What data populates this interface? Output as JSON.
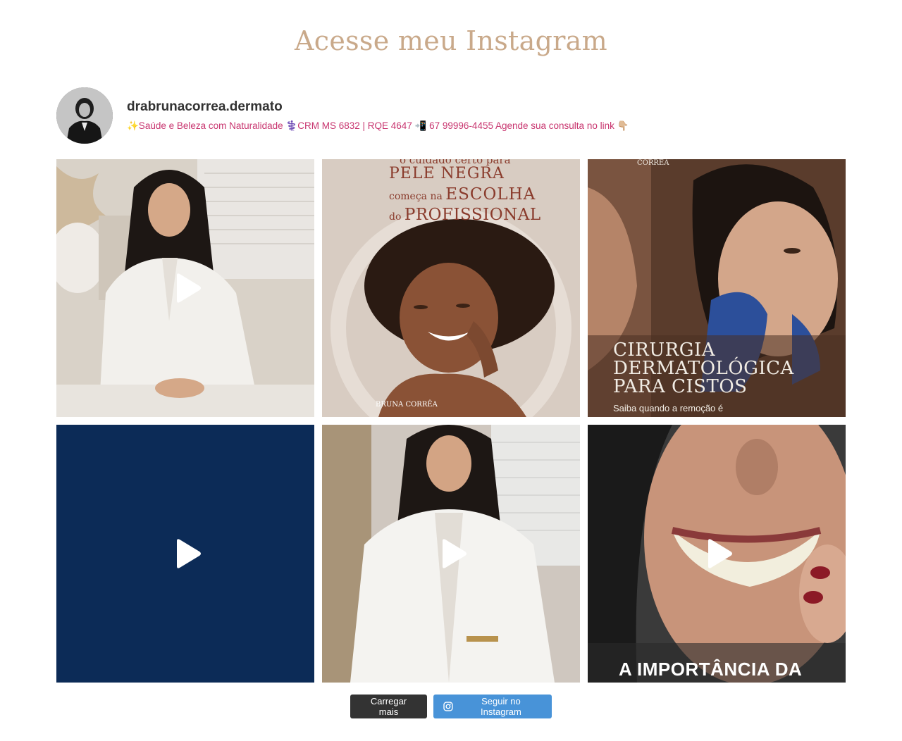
{
  "section": {
    "title": "Acesse meu Instagram"
  },
  "profile": {
    "username": "drabrunacorrea.dermato",
    "bio": "✨Saúde e Beleza com Naturalidade ⚕️CRM MS 6832 | RQE 4647 📲 67 99996-4455 Agende sua consulta no link 👇🏼"
  },
  "posts": [
    {
      "kind": "video",
      "icon": "play-icon"
    },
    {
      "kind": "image",
      "text_top": "o cuidado certo para",
      "text_line1": "PELE NEGRA",
      "text_line2_small": "começa na",
      "text_line2_big": "ESCOLHA",
      "text_line3_small": "do",
      "text_line3_big": "PROFISSIONAL",
      "brand": "BRUNA CORRÊA"
    },
    {
      "kind": "image",
      "brand": "CORRÊA",
      "headline": "CIRURGIA DERMATOLÓGICA PARA CISTOS",
      "caption": "Saiba quando a remoção é"
    },
    {
      "kind": "video",
      "icon": "play-icon"
    },
    {
      "kind": "video",
      "icon": "play-icon"
    },
    {
      "kind": "video",
      "icon": "play-icon",
      "overlay": "A IMPORTÂNCIA DA"
    }
  ],
  "actions": {
    "load_more": "Carregar mais",
    "follow": "Seguir no Instagram",
    "follow_icon": "instagram-icon"
  },
  "colors": {
    "title": "#c9a98a",
    "bio": "#c8356f",
    "load_button": "#333333",
    "follow_button": "#4893d8",
    "navy_tile": "#0c2b57"
  }
}
